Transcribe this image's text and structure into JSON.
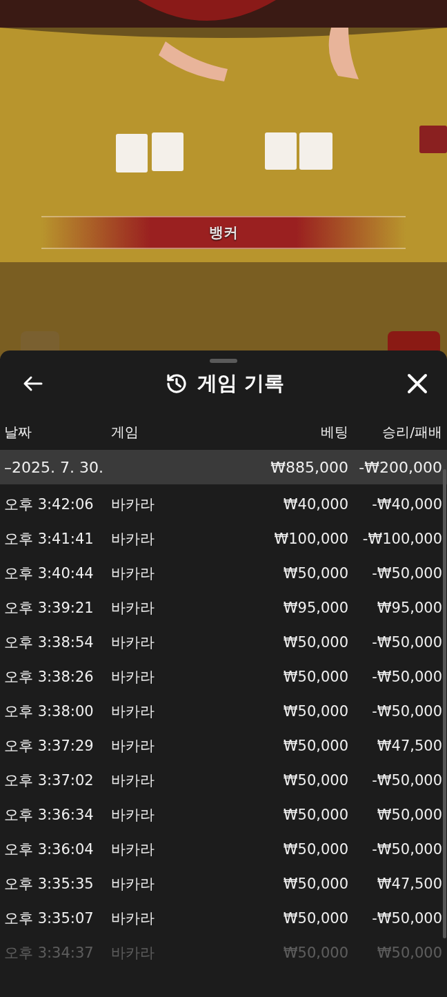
{
  "video": {
    "result_banner": "뱅커"
  },
  "sheet": {
    "title": "게임 기록",
    "columns": [
      "날짜",
      "게임",
      "베팅",
      "승리/패배"
    ],
    "group": {
      "date": "–2025. 7. 30.",
      "bet": "₩885,000",
      "result": "-₩200,000",
      "expanded": true
    },
    "rows": [
      {
        "time": "오후 3:42:06",
        "game": "바카라",
        "bet": "₩40,000",
        "result": "-₩40,000",
        "faded": false
      },
      {
        "time": "오후 3:41:41",
        "game": "바카라",
        "bet": "₩100,000",
        "result": "-₩100,000",
        "faded": false
      },
      {
        "time": "오후 3:40:44",
        "game": "바카라",
        "bet": "₩50,000",
        "result": "-₩50,000",
        "faded": false
      },
      {
        "time": "오후 3:39:21",
        "game": "바카라",
        "bet": "₩95,000",
        "result": "₩95,000",
        "faded": false
      },
      {
        "time": "오후 3:38:54",
        "game": "바카라",
        "bet": "₩50,000",
        "result": "-₩50,000",
        "faded": false
      },
      {
        "time": "오후 3:38:26",
        "game": "바카라",
        "bet": "₩50,000",
        "result": "-₩50,000",
        "faded": false
      },
      {
        "time": "오후 3:38:00",
        "game": "바카라",
        "bet": "₩50,000",
        "result": "-₩50,000",
        "faded": false
      },
      {
        "time": "오후 3:37:29",
        "game": "바카라",
        "bet": "₩50,000",
        "result": "₩47,500",
        "faded": false
      },
      {
        "time": "오후 3:37:02",
        "game": "바카라",
        "bet": "₩50,000",
        "result": "-₩50,000",
        "faded": false
      },
      {
        "time": "오후 3:36:34",
        "game": "바카라",
        "bet": "₩50,000",
        "result": "₩50,000",
        "faded": false
      },
      {
        "time": "오후 3:36:04",
        "game": "바카라",
        "bet": "₩50,000",
        "result": "-₩50,000",
        "faded": false
      },
      {
        "time": "오후 3:35:35",
        "game": "바카라",
        "bet": "₩50,000",
        "result": "₩47,500",
        "faded": false
      },
      {
        "time": "오후 3:35:07",
        "game": "바카라",
        "bet": "₩50,000",
        "result": "-₩50,000",
        "faded": false
      },
      {
        "time": "오후 3:34:37",
        "game": "바카라",
        "bet": "₩50,000",
        "result": "₩50,000",
        "faded": true
      }
    ]
  }
}
